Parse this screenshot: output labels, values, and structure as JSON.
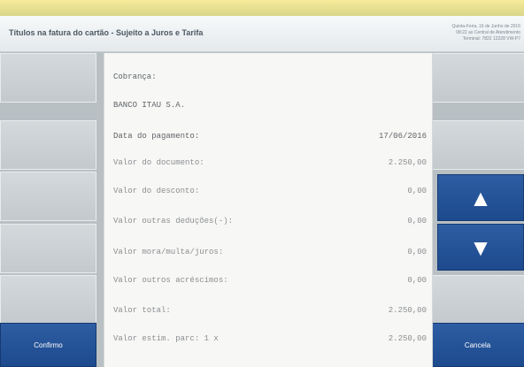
{
  "header": {
    "title": "Títulos na fatura do cartão - Sujeito a Juros e Tarifa",
    "meta_lines": [
      "Quinta-Feira, 16 de Junho de 2016",
      "08:22 as Central de Atendimento",
      "Terminal: 7822 12228 VW-P7"
    ]
  },
  "receipt": {
    "heading": "Cobrança:",
    "payee": "BANCO ITAU S.A.",
    "rows": [
      {
        "label": "Data do pagamento:",
        "value": "17/06/2016"
      },
      {
        "label": "Valor do documento:",
        "value": "2.250,00"
      },
      {
        "label": "Valor do desconto:",
        "value": "0,00"
      },
      {
        "label": "Valor outras deduções(-):",
        "value": "0,00"
      },
      {
        "label": "Valor mora/multa/juros:",
        "value": "0,00"
      },
      {
        "label": "Valor outros acréscimos:",
        "value": "0,00"
      },
      {
        "label": "Valor total:",
        "value": "2.250,00"
      },
      {
        "label": "Valor estim. parc:   1 x",
        "value": "2.250,00"
      }
    ]
  },
  "buttons": {
    "confirm": "Confirmo",
    "cancel": "Cancela",
    "scroll_up_icon": "triangle-up",
    "scroll_down_icon": "triangle-down"
  },
  "colors": {
    "accent_blue": "#1d4a8d",
    "top_strip": "#f0e79a",
    "panel_gray": "#c3c9cd"
  }
}
